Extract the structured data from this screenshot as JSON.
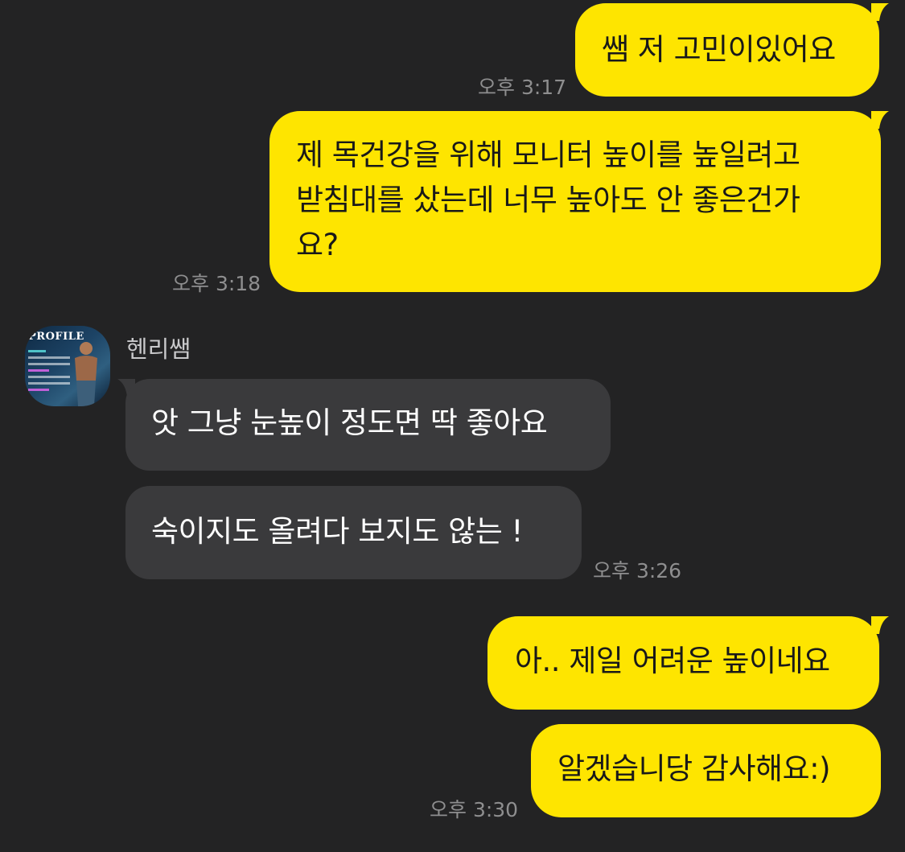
{
  "messages_me_top": [
    {
      "text": "쌤 저 고민이있어요",
      "time": "오후 3:17"
    },
    {
      "lines": [
        "제 목건강을 위해 모니터 높이를 높일려고",
        "받침대를 샀는데 너무 높아도 안 좋은건가",
        "요?"
      ],
      "time": "오후 3:18"
    }
  ],
  "partner": {
    "name": "헨리쌤",
    "avatar_text": "PROFILE"
  },
  "messages_them": [
    {
      "text": "앗 그냥 눈높이 정도면 딱 좋아요"
    },
    {
      "text": "숙이지도 올려다 보지도 않는 !",
      "time": "오후 3:26"
    }
  ],
  "messages_me_bottom": [
    {
      "text": "아.. 제일 어려운 높이네요"
    },
    {
      "text": "알겠습니당 감사해요:)",
      "time": "오후 3:30"
    }
  ],
  "colors": {
    "background": "#232324",
    "my_bubble": "#FEE500",
    "their_bubble": "#3A3A3C",
    "timestamp": "#8E8E8F"
  }
}
